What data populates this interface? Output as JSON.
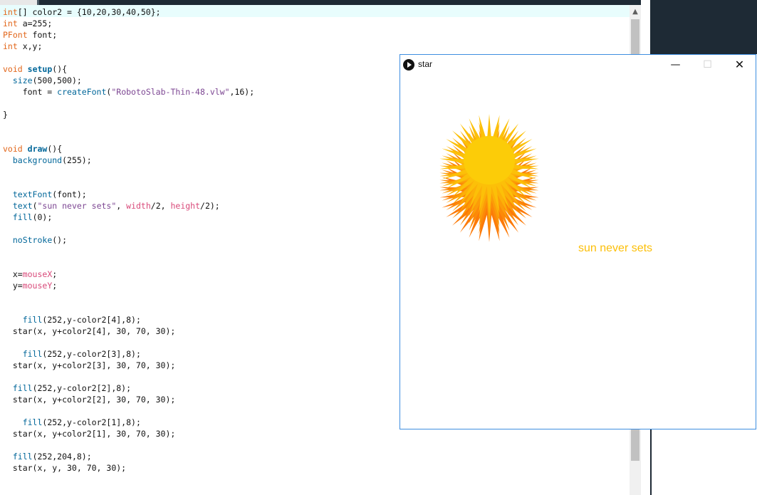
{
  "editor": {
    "code_lines": [
      "int[] color2 = {10,20,30,40,50};",
      "int a=255;",
      "PFont font;",
      "int x,y;",
      "",
      "void setup(){",
      "  size(500,500);",
      "    font = createFont(\"RobotoSlab-Thin-48.vlw\",16);",
      "",
      "}",
      "",
      "",
      "void draw(){",
      "  background(255);",
      "",
      "",
      "  textFont(font);",
      "  text(\"sun never sets\", width/2, height/2);",
      "  fill(0);",
      "",
      "  noStroke();",
      "",
      "",
      "  x=mouseX;",
      "  y=mouseY;",
      "",
      "",
      "    fill(252,y-color2[4],8);",
      "  star(x, y+color2[4], 30, 70, 30);",
      "",
      "    fill(252,y-color2[3],8);",
      "  star(x, y+color2[3], 30, 70, 30);",
      "",
      "  fill(252,y-color2[2],8);",
      "  star(x, y+color2[2], 30, 70, 30);",
      "",
      "    fill(252,y-color2[1],8);",
      "  star(x, y+color2[1], 30, 70, 30);",
      "",
      "  fill(252,204,8);",
      "  star(x, y, 30, 70, 30);"
    ],
    "scroll_up_icon": "triangle-up-icon"
  },
  "sketch_window": {
    "title": "star",
    "app_icon": "play-icon",
    "minimize_icon": "minimize-icon",
    "maximize_icon": "maximize-icon",
    "close_icon": "close-icon",
    "canvas_text": "sun never sets"
  },
  "colors": {
    "keyword": "#e2661a",
    "function": "#006699",
    "string": "#7d4793",
    "variable": "#d94a7a",
    "sun_core": "#fccc08",
    "sun_text": "#fcbf08",
    "window_border": "#3e8ee0"
  }
}
